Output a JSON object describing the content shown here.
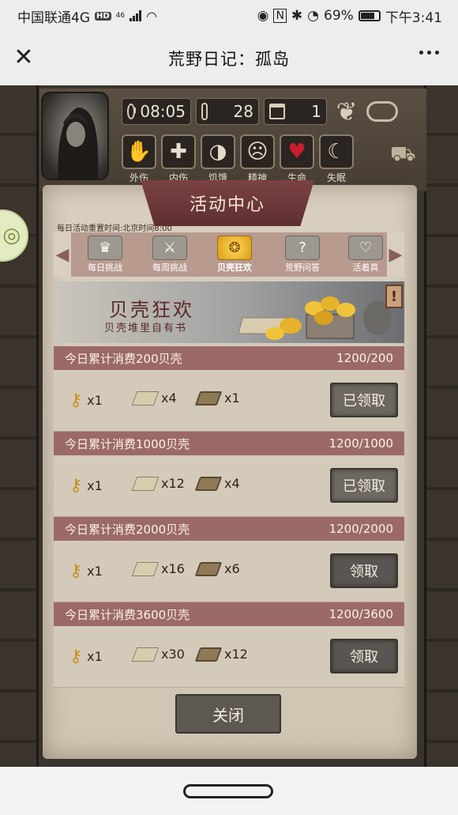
{
  "status_bar": {
    "carrier": "中国联通4G",
    "hd_badge": "HD",
    "signal_label": "46",
    "battery_percent": "69%",
    "time": "下午3:41"
  },
  "title_bar": {
    "title": "荒野日记：孤岛",
    "close_icon": "close-icon",
    "more_icon": "more-icon"
  },
  "hud": {
    "time": "08:05",
    "temperature": "28",
    "day": "1",
    "stats": [
      {
        "label": "外伤",
        "icon": "hand-icon"
      },
      {
        "label": "内伤",
        "icon": "cross-icon"
      },
      {
        "label": "饥饿",
        "icon": "stomach-icon"
      },
      {
        "label": "精神",
        "icon": "head-icon"
      },
      {
        "label": "生命",
        "icon": "heart-icon"
      },
      {
        "label": "失眠",
        "icon": "moon-icon"
      }
    ]
  },
  "panel": {
    "title": "活动中心",
    "reset_note": "每日活动重置时间:北京时间8:00",
    "tabs": [
      {
        "label": "每日挑战"
      },
      {
        "label": "每周挑战"
      },
      {
        "label": "贝壳狂欢"
      },
      {
        "label": "荒野问答"
      },
      {
        "label": "活着真"
      }
    ],
    "event_title": "贝壳狂欢",
    "event_subtitle": "贝壳堆里自有书",
    "info_badge": "!",
    "tasks": [
      {
        "title": "今日累计消费200贝壳",
        "progress": "1200/200",
        "key": "x1",
        "paper": "x4",
        "scroll": "x1",
        "button": "已领取"
      },
      {
        "title": "今日累计消费1000贝壳",
        "progress": "1200/1000",
        "key": "x1",
        "paper": "x12",
        "scroll": "x4",
        "button": "已领取"
      },
      {
        "title": "今日累计消费2000贝壳",
        "progress": "1200/2000",
        "key": "x1",
        "paper": "x16",
        "scroll": "x6",
        "button": "领取"
      },
      {
        "title": "今日累计消费3600贝壳",
        "progress": "1200/3600",
        "key": "x1",
        "paper": "x30",
        "scroll": "x12",
        "button": "领取"
      }
    ],
    "close_label": "关闭"
  }
}
